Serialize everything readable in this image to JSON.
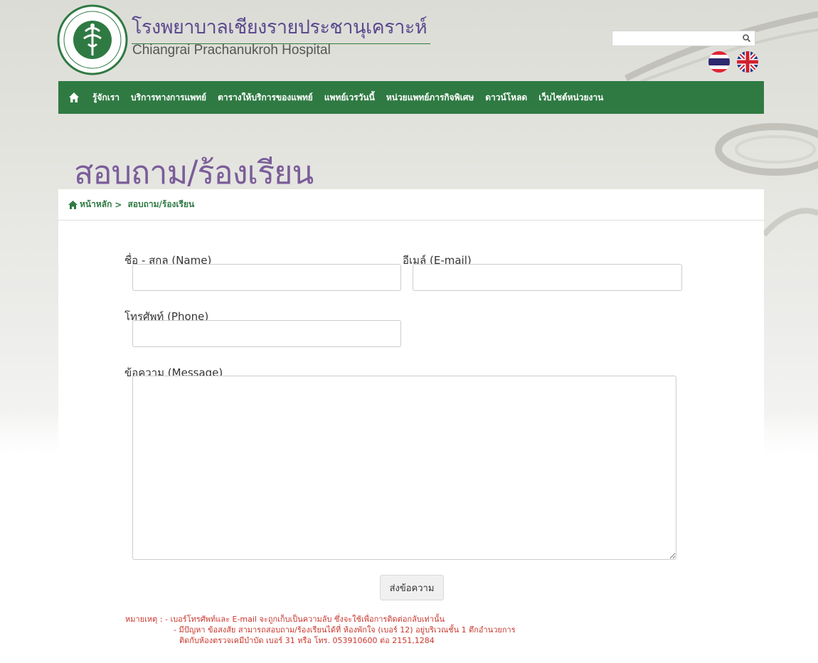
{
  "header": {
    "site_title_th": "โรงพยาบาลเชียงรายประชานุเคราะห์",
    "site_title_en": "Chiangrai Prachanukroh Hospital",
    "search_placeholder": "",
    "logo_icon": "ministry-of-public-health-seal-icon",
    "flags": [
      "thai-flag-icon",
      "uk-flag-icon"
    ]
  },
  "nav": {
    "home_icon": "home-icon",
    "items": [
      {
        "label": "รู้จักเรา"
      },
      {
        "label": "บริการทางการแพทย์"
      },
      {
        "label": "ตารางให้บริการของแพทย์"
      },
      {
        "label": "แพทย์เวรวันนี้"
      },
      {
        "label": "หน่วยแพทย์ภารกิจพิเศษ"
      },
      {
        "label": "ดาวน์โหลด"
      },
      {
        "label": "เว็บไซต์หน่วยงาน"
      }
    ]
  },
  "page": {
    "title": "สอบถาม/ร้องเรียน"
  },
  "breadcrumb": {
    "home": "หน้าหลัก",
    "separator": ">",
    "current": "สอบถาม/ร้องเรียน"
  },
  "form": {
    "name_label": "ชื่อ - สกุล (Name)",
    "email_label": "อีเมล์ (E-mail)",
    "phone_label": "โทรศัพท์ (Phone)",
    "message_label": "ข้อความ (Message)",
    "name_value": "",
    "email_value": "",
    "phone_value": "",
    "message_value": "",
    "submit_label": "ส่งข้อความ"
  },
  "notes": {
    "line1": "หมายเหตุ : - เบอร์โทรศัพท์และ E-mail จะถูกเก็บเป็นความลับ ซึ่งจะใช้เพื่อการติดต่อกลับเท่านั้น",
    "line2": "- มีปัญหา ข้อสงสัย สามารถสอบถาม/ร้องเรียนได้ที่ ห้องพักใจ (เบอร์ 12) อยู่บริเวณชั้น 1 ตึกอำนวยการ",
    "line3": "ติดกับห้องตรวจเคมีบำบัด เบอร์ 31 หรือ โทร. 053910600 ต่อ 2151,1284"
  },
  "colors": {
    "nav_bg": "#2f7a43",
    "title_purple": "#7a5d99",
    "note_red": "#c8372d"
  }
}
